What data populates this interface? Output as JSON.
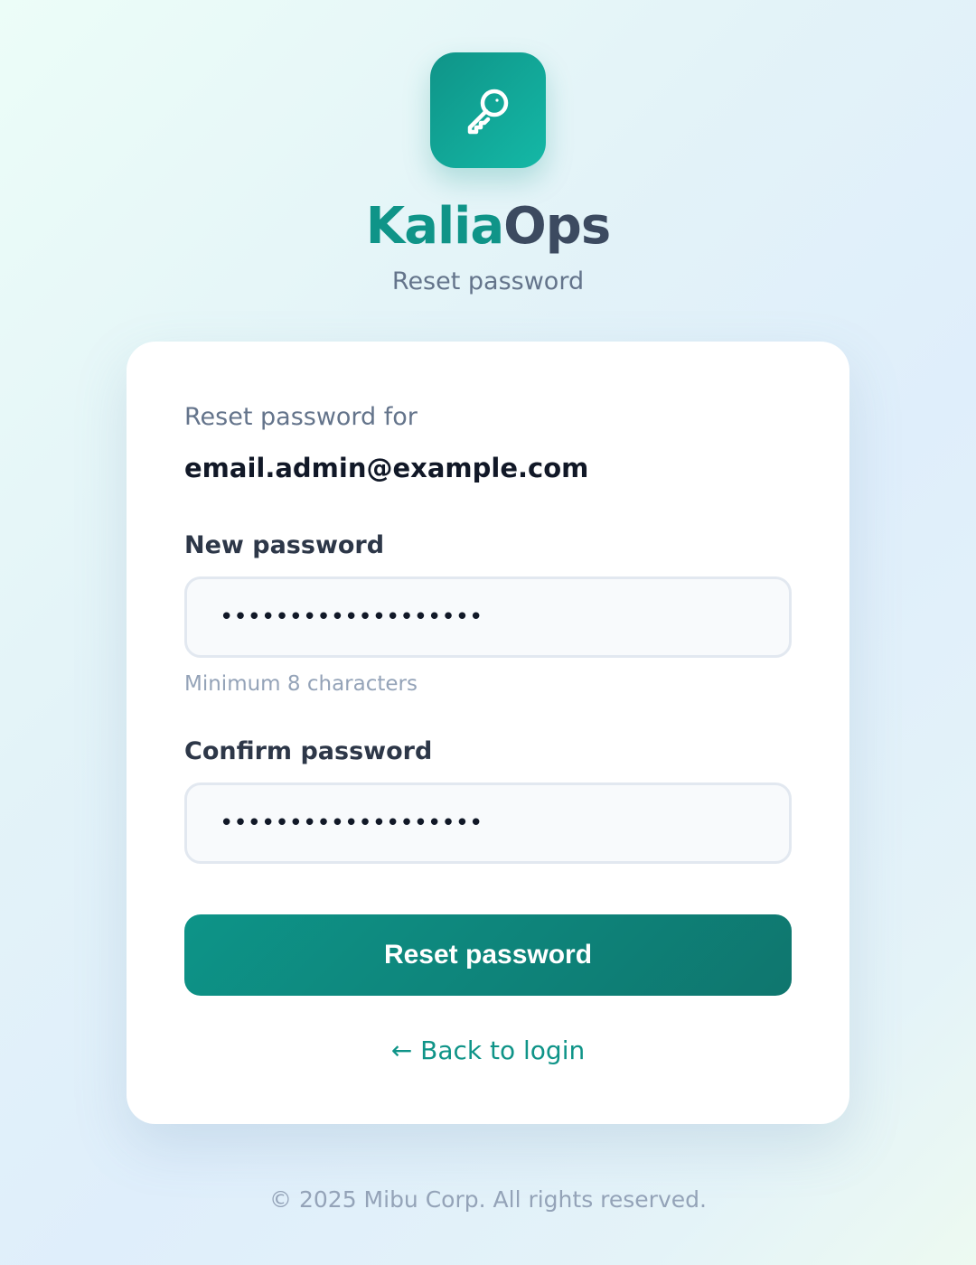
{
  "brand": {
    "name_part1": "Kalia",
    "name_part2": "Ops",
    "logo_icon": "key-icon",
    "accent_color": "#0f9488"
  },
  "page": {
    "subtitle": "Reset password"
  },
  "form": {
    "intro_label": "Reset password for",
    "email": "email.admin@example.com",
    "new_password": {
      "label": "New password",
      "value": "•••••••••••••••••••",
      "hint": "Minimum 8 characters"
    },
    "confirm_password": {
      "label": "Confirm password",
      "value": "•••••••••••••••••••"
    },
    "submit_label": "Reset password",
    "back_link": "← Back to login"
  },
  "footer": {
    "copyright": "© 2025 Mibu Corp. All rights reserved."
  }
}
